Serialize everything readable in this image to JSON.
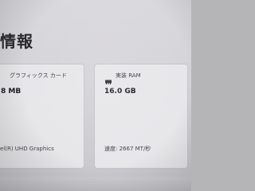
{
  "section": {
    "title": "情報"
  },
  "gpu_card": {
    "label": "グラフィックス カード",
    "value": "8 MB",
    "footer": "el(R) UHD Graphics"
  },
  "ram_card": {
    "icon": "memory-icon",
    "label": "実装 RAM",
    "value": "16.0 GB",
    "footer": "速度: 2667 MT/秒"
  }
}
